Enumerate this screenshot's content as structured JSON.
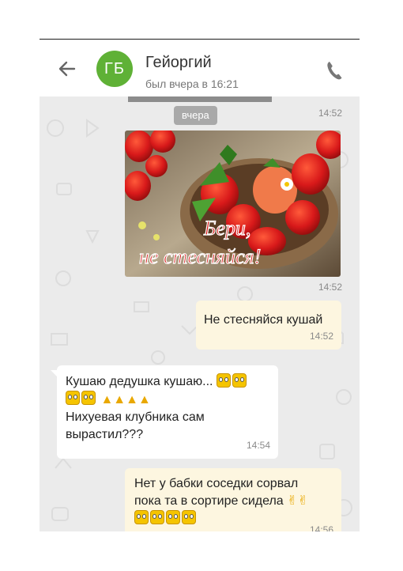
{
  "header": {
    "avatar_initials": "ГБ",
    "contact_name": "Гейоргий",
    "last_seen": "был вчера в 16:21"
  },
  "chat": {
    "date_separator": "вчера",
    "top_time": "14:52",
    "photo": {
      "caption_line1": "Бери,",
      "caption_line2": "не стесняйся!",
      "time": "14:52"
    },
    "messages": [
      {
        "direction": "outgoing",
        "text": "Не стесняйся кушай",
        "time": "14:52"
      },
      {
        "direction": "incoming",
        "line1": "Кушаю дедушка кушаю...",
        "line2": "Нихуевая клубника сам",
        "line3": "вырастил???",
        "time": "14:54"
      },
      {
        "direction": "outgoing",
        "line1": "Нет у бабки соседки сорвал",
        "line2": "пока та в сортире сидела",
        "time": "14:56"
      }
    ]
  },
  "colors": {
    "avatar": "#5fb136",
    "outgoing_bubble": "#fdf6e0",
    "chat_bg": "#ebebeb"
  },
  "icons": [
    "back-arrow-icon",
    "phone-icon",
    "emoji-icon",
    "thumbs-up-icon",
    "victory-hand-icon"
  ]
}
